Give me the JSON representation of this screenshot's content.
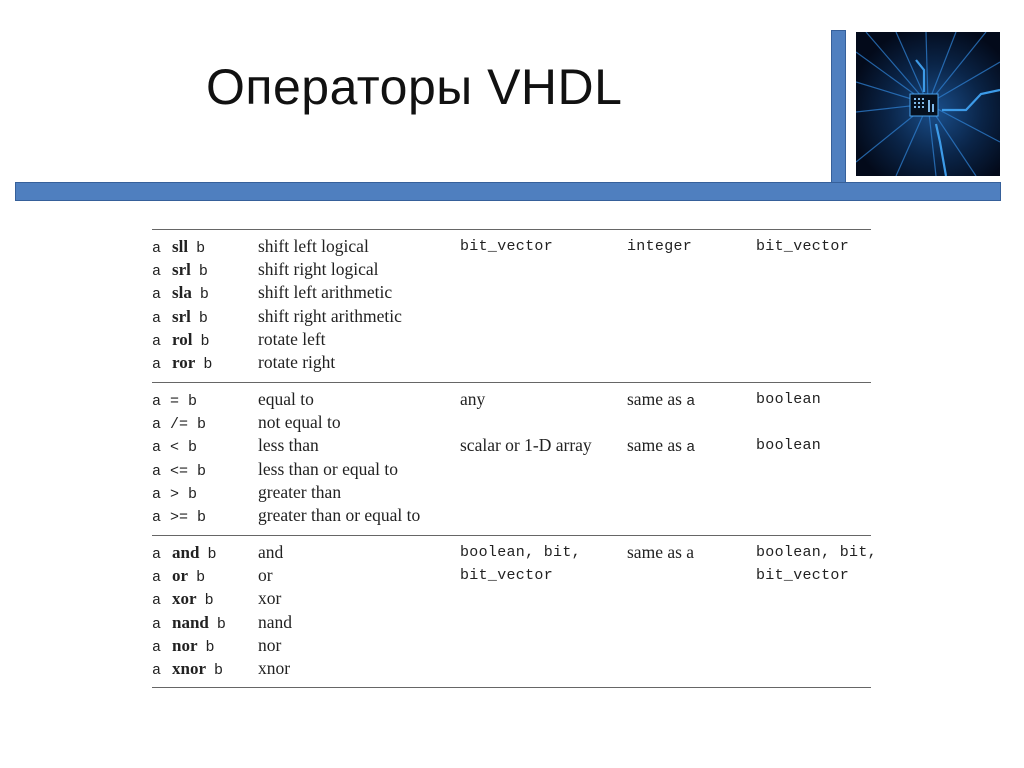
{
  "slide": {
    "title": "Операторы VHDL",
    "accent_color": "#4f7fbf",
    "image_icon": "circuit-chip-image"
  },
  "table": {
    "groups": [
      {
        "rows": [
          {
            "a": "a",
            "op": "sll",
            "op_style": "keyword",
            "b": "b",
            "desc": "shift left logical"
          },
          {
            "a": "a",
            "op": "srl",
            "op_style": "keyword",
            "b": "b",
            "desc": "shift right logical"
          },
          {
            "a": "a",
            "op": "sla",
            "op_style": "keyword",
            "b": "b",
            "desc": "shift left arithmetic"
          },
          {
            "a": "a",
            "op": "srl",
            "op_style": "keyword",
            "b": "b",
            "desc": "shift right arithmetic"
          },
          {
            "a": "a",
            "op": "rol",
            "op_style": "keyword",
            "b": "b",
            "desc": "rotate left"
          },
          {
            "a": "a",
            "op": "ror",
            "op_style": "keyword",
            "b": "b",
            "desc": "rotate right"
          }
        ],
        "type_cells": [
          {
            "row": 0,
            "operand_a": "bit_vector",
            "operand_a_style": "mono",
            "operand_b": "integer",
            "operand_b_style": "mono",
            "result": "bit_vector",
            "result_style": "mono"
          }
        ]
      },
      {
        "rows": [
          {
            "a": "a",
            "op": "=",
            "op_style": "symbol",
            "b": "b",
            "desc": "equal to"
          },
          {
            "a": "a",
            "op": "/=",
            "op_style": "symbol",
            "b": "b",
            "desc": "not equal to"
          },
          {
            "a": "a",
            "op": "<",
            "op_style": "symbol",
            "b": "b",
            "desc": "less than"
          },
          {
            "a": "a",
            "op": "<=",
            "op_style": "symbol",
            "b": "b",
            "desc": "less than or equal to"
          },
          {
            "a": "a",
            "op": ">",
            "op_style": "symbol",
            "b": "b",
            "desc": "greater than"
          },
          {
            "a": "a",
            "op": ">=",
            "op_style": "symbol",
            "b": "b",
            "desc": "greater than or equal to"
          }
        ],
        "type_cells": [
          {
            "row": 0,
            "operand_a": "any",
            "operand_a_style": "serif",
            "operand_b_text": "same as ",
            "operand_b_code": "a",
            "result": "boolean",
            "result_style": "mono"
          },
          {
            "row": 2,
            "operand_a": "scalar or 1-D array",
            "operand_a_style": "serif",
            "operand_b_text": "same as ",
            "operand_b_code": "a",
            "result": "boolean",
            "result_style": "mono"
          }
        ]
      },
      {
        "rows": [
          {
            "a": "a",
            "op": "and",
            "op_style": "keyword",
            "b": "b",
            "desc": "and"
          },
          {
            "a": "a",
            "op": "or",
            "op_style": "keyword",
            "b": "b",
            "desc": "or"
          },
          {
            "a": "a",
            "op": "xor",
            "op_style": "keyword",
            "b": "b",
            "desc": "xor"
          },
          {
            "a": "a",
            "op": "nand",
            "op_style": "keyword",
            "b": "b",
            "desc": "nand"
          },
          {
            "a": "a",
            "op": "nor",
            "op_style": "keyword",
            "b": "b",
            "desc": "nor"
          },
          {
            "a": "a",
            "op": "xnor",
            "op_style": "keyword",
            "b": "b",
            "desc": "xnor"
          }
        ],
        "type_cells": [
          {
            "row": 0,
            "operand_a": "boolean, bit,",
            "operand_a_style": "mono",
            "operand_b": "same as a",
            "operand_b_style": "serif",
            "result": "boolean, bit,",
            "result_style": "mono"
          },
          {
            "row": 1,
            "operand_a": "bit_vector",
            "operand_a_style": "mono",
            "result": "bit_vector",
            "result_style": "mono"
          }
        ]
      }
    ]
  }
}
